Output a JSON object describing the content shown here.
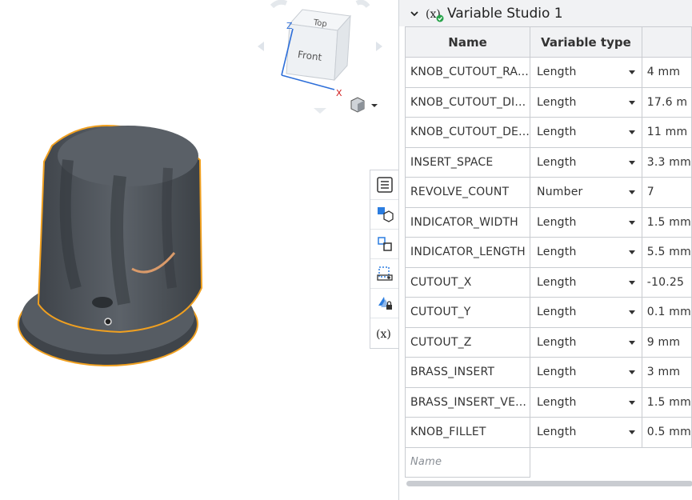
{
  "panel": {
    "title": "Variable Studio 1",
    "columns": {
      "name": "Name",
      "type": "Variable type"
    },
    "new_row_placeholder": "Name",
    "variables": [
      {
        "name": "KNOB_CUTOUT_RA...",
        "type": "Length",
        "value": "4 mm"
      },
      {
        "name": "KNOB_CUTOUT_DI...",
        "type": "Length",
        "value": "17.6 m"
      },
      {
        "name": "KNOB_CUTOUT_DE...",
        "type": "Length",
        "value": "11 mm"
      },
      {
        "name": "INSERT_SPACE",
        "type": "Length",
        "value": "3.3 mm"
      },
      {
        "name": "REVOLVE_COUNT",
        "type": "Number",
        "value": "7"
      },
      {
        "name": "INDICATOR_WIDTH",
        "type": "Length",
        "value": "1.5 mm"
      },
      {
        "name": "INDICATOR_LENGTH",
        "type": "Length",
        "value": "5.5 mm"
      },
      {
        "name": "CUTOUT_X",
        "type": "Length",
        "value": "-10.25"
      },
      {
        "name": "CUTOUT_Y",
        "type": "Length",
        "value": "0.1 mm"
      },
      {
        "name": "CUTOUT_Z",
        "type": "Length",
        "value": "9 mm"
      },
      {
        "name": "BRASS_INSERT",
        "type": "Length",
        "value": "3 mm"
      },
      {
        "name": "BRASS_INSERT_VE...",
        "type": "Length",
        "value": "1.5 mm"
      },
      {
        "name": "KNOB_FILLET",
        "type": "Length",
        "value": "0.5 mm"
      }
    ]
  },
  "viewcube": {
    "top_label": "Top",
    "front_label": "Front",
    "x_axis": "X",
    "z_axis": "Z"
  },
  "colors": {
    "accent": "#2b7de0",
    "selection": "#f0a020",
    "model": "#4a4f55",
    "indicator": "#d99a6a"
  },
  "icons": [
    "chevron-down-icon",
    "variable-studio-icon",
    "feature-list-icon",
    "parts-icon",
    "mates-icon",
    "display-states-icon",
    "appearance-lock-icon",
    "variables-icon",
    "display-mode-icon"
  ]
}
